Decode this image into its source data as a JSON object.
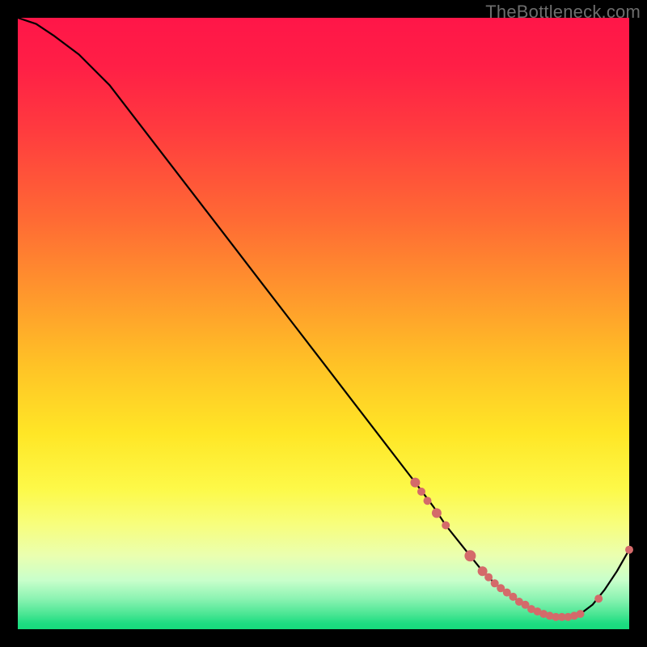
{
  "watermark": "TheBottleneck.com",
  "chart_data": {
    "type": "line",
    "title": "",
    "xlabel": "",
    "ylabel": "",
    "xlim": [
      0,
      100
    ],
    "ylim": [
      0,
      100
    ],
    "series": [
      {
        "name": "bottleneck-curve",
        "x": [
          0,
          3,
          6,
          10,
          15,
          20,
          25,
          30,
          35,
          40,
          45,
          50,
          55,
          60,
          65,
          68,
          70,
          72,
          74,
          76,
          78,
          80,
          82,
          84,
          86,
          88,
          90,
          92,
          94,
          96,
          98,
          100
        ],
        "y": [
          100,
          99,
          97,
          94,
          89,
          82.5,
          76,
          69.5,
          63,
          56.5,
          50,
          43.5,
          37,
          30.5,
          24,
          20,
          17,
          14.5,
          12,
          9.5,
          7.5,
          6,
          4.5,
          3.3,
          2.5,
          2,
          2,
          2.5,
          4,
          6.5,
          9.5,
          13
        ]
      }
    ],
    "highlight_dots": {
      "name": "curve-markers",
      "x": [
        65,
        66,
        67,
        68.5,
        70,
        74,
        76,
        77,
        78,
        79,
        80,
        81,
        82,
        83,
        84,
        85,
        86,
        87,
        88,
        89,
        90,
        91,
        92,
        95,
        100
      ],
      "y": [
        24,
        22.5,
        21,
        19,
        17,
        12,
        9.5,
        8.5,
        7.5,
        6.7,
        6,
        5.3,
        4.5,
        4,
        3.3,
        2.9,
        2.5,
        2.2,
        2,
        2,
        2,
        2.2,
        2.5,
        5,
        13
      ],
      "r": [
        6,
        5,
        5,
        6,
        5,
        7,
        6,
        5,
        5,
        5,
        5,
        5,
        5,
        5,
        5,
        5,
        5,
        5,
        5,
        5,
        5,
        5,
        5,
        5,
        5
      ]
    }
  }
}
